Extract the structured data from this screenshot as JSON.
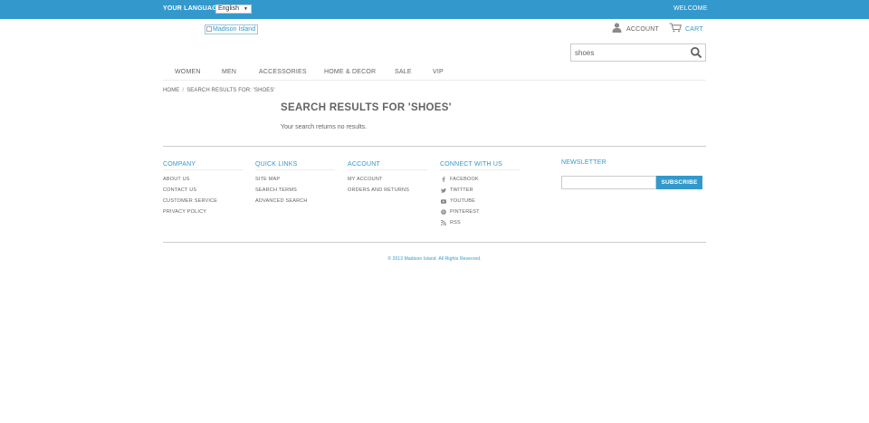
{
  "topbar": {
    "language_label": "YOUR LANGUAGE:",
    "language_selected": "English",
    "welcome": "WELCOME"
  },
  "header": {
    "logo_alt": "Madison Island",
    "account_label": "ACCOUNT",
    "cart_label": "CART"
  },
  "search": {
    "value": "shoes"
  },
  "nav": {
    "items": [
      "WOMEN",
      "MEN",
      "ACCESSORIES",
      "HOME & DECOR",
      "SALE",
      "VIP"
    ]
  },
  "breadcrumb": {
    "home": "HOME",
    "separator": "/",
    "current": "SEARCH RESULTS FOR: 'SHOES'"
  },
  "main": {
    "title": "SEARCH RESULTS FOR 'SHOES'",
    "message": "Your search returns no results."
  },
  "footer": {
    "company": {
      "title": "COMPANY",
      "links": [
        "ABOUT US",
        "CONTACT US",
        "CUSTOMER SERVICE",
        "PRIVACY POLICY"
      ]
    },
    "quick_links": {
      "title": "QUICK LINKS",
      "links": [
        "SITE MAP",
        "SEARCH TERMS",
        "ADVANCED SEARCH"
      ]
    },
    "account": {
      "title": "ACCOUNT",
      "links": [
        "MY ACCOUNT",
        "ORDERS AND RETURNS"
      ]
    },
    "connect": {
      "title": "CONNECT WITH US",
      "links": [
        {
          "label": "FACEBOOK",
          "icon": "facebook-icon"
        },
        {
          "label": "TWITTER",
          "icon": "twitter-icon"
        },
        {
          "label": "YOUTUBE",
          "icon": "youtube-icon"
        },
        {
          "label": "PINTEREST",
          "icon": "pinterest-icon"
        },
        {
          "label": "RSS",
          "icon": "rss-icon"
        }
      ]
    },
    "newsletter": {
      "title": "NEWSLETTER",
      "email_value": "",
      "button": "SUBSCRIBE"
    },
    "copyright": "© 2013 Madison Island. All Rights Reserved."
  },
  "colors": {
    "accent": "#3399cc",
    "text": "#636363",
    "rule": "#cccccc"
  }
}
